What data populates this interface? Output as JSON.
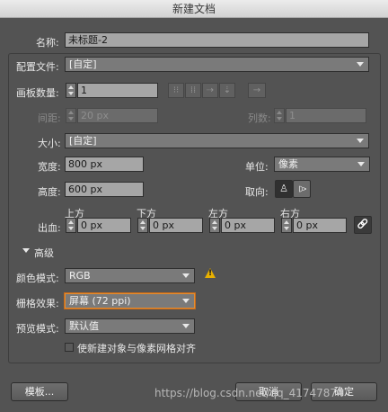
{
  "window": {
    "title": "新建文档"
  },
  "name": {
    "label": "名称:",
    "value": "未标题-2"
  },
  "profile": {
    "label": "配置文件:",
    "value": "[自定]"
  },
  "artboards": {
    "count_label": "画板数量:",
    "count_value": "1",
    "spacing_label": "间距:",
    "spacing_value": "20 px",
    "columns_label": "列数:",
    "columns_value": "1",
    "layout_icons": [
      "grid-by-row-icon",
      "grid-by-column-icon",
      "arrange-by-row-icon",
      "arrange-by-column-icon",
      "right-to-left-icon"
    ],
    "layout_glyphs": [
      "⁝⁝",
      "⁞⁞",
      "⇢",
      "⇣",
      "→"
    ]
  },
  "size": {
    "label": "大小:",
    "value": "[自定]"
  },
  "width": {
    "label": "宽度:",
    "value": "800 px"
  },
  "units": {
    "label": "单位:",
    "value": "像素"
  },
  "height": {
    "label": "高度:",
    "value": "600 px"
  },
  "orientation": {
    "label": "取向:",
    "portrait_glyph": "♙",
    "landscape_glyph": "♙"
  },
  "bleed": {
    "label": "出血:",
    "top_label": "上方",
    "top_value": "0 px",
    "bottom_label": "下方",
    "bottom_value": "0 px",
    "left_label": "左方",
    "left_value": "0 px",
    "right_label": "右方",
    "right_value": "0 px",
    "link_glyph": "🔗"
  },
  "advanced": {
    "label": "高级",
    "color_mode_label": "颜色模式:",
    "color_mode_value": "RGB",
    "raster_label": "栅格效果:",
    "raster_value": "屏幕 (72 ppi)",
    "preview_label": "预览模式:",
    "preview_value": "默认值",
    "align_label": "使新建对象与像素网格对齐",
    "warn_glyph": "!"
  },
  "buttons": {
    "templates": "模板...",
    "cancel": "取消",
    "ok": "确定"
  },
  "watermark": "https://blog.csdn.net/qq_41747874",
  "colors": {
    "accent": "#e58d2f",
    "warning": "#e8b000"
  }
}
